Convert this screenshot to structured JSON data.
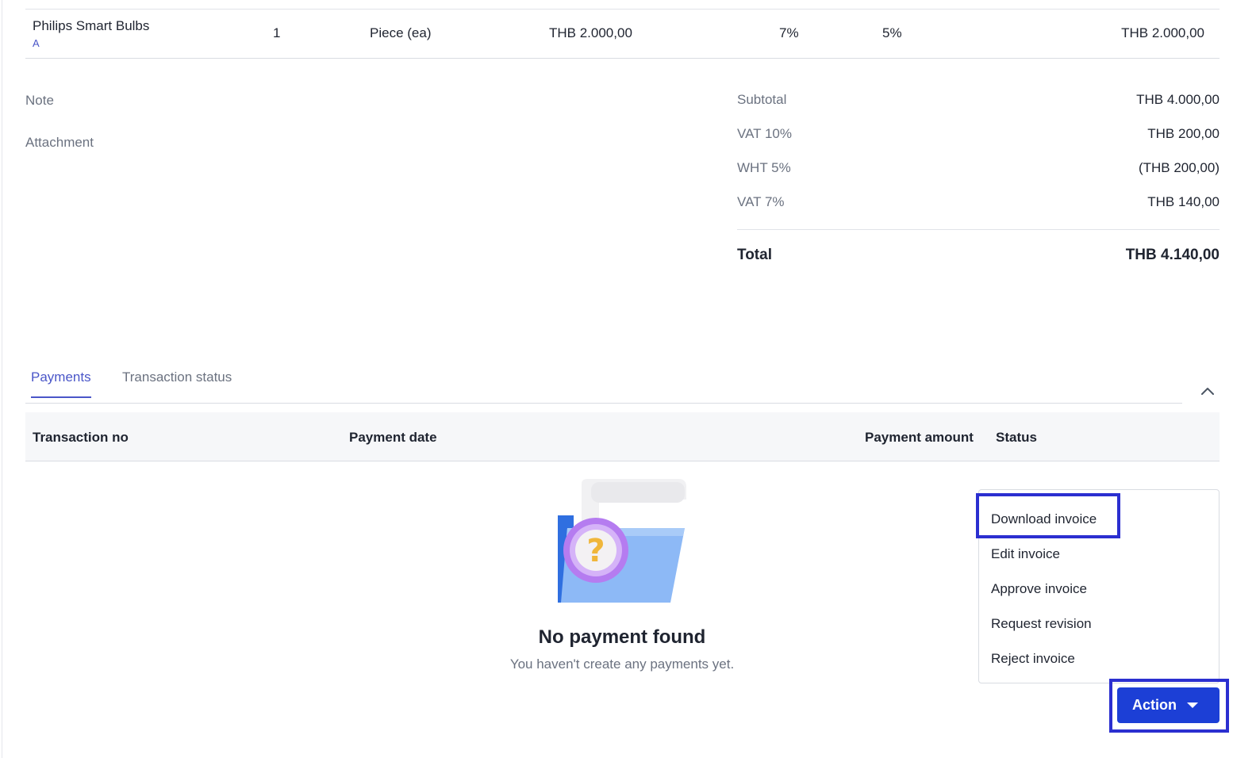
{
  "line_item": {
    "name": "Philips Smart Bulbs",
    "sub": "A",
    "quantity": "1",
    "unit": "Piece (ea)",
    "unit_price": "THB 2.000,00",
    "vat": "7%",
    "wht": "5%",
    "amount": "THB 2.000,00"
  },
  "meta": {
    "note_label": "Note",
    "attachment_label": "Attachment"
  },
  "summary": {
    "rows": [
      {
        "label": "Subtotal",
        "value": "THB 4.000,00"
      },
      {
        "label": "VAT 10%",
        "value": "THB 200,00"
      },
      {
        "label": "WHT 5%",
        "value": "(THB 200,00)"
      },
      {
        "label": "VAT 7%",
        "value": "THB 140,00"
      }
    ],
    "total_label": "Total",
    "total_value": "THB 4.140,00"
  },
  "tabs": {
    "payments": "Payments",
    "transaction_status": "Transaction status",
    "active": "payments"
  },
  "payments_table": {
    "columns": [
      "Transaction no",
      "Payment date",
      "Payment amount",
      "Status"
    ]
  },
  "empty_state": {
    "title": "No payment found",
    "subtitle": "You haven't create any payments yet.",
    "icon": "folder-question-illustration"
  },
  "action_menu": {
    "items": [
      "Download invoice",
      "Edit invoice",
      "Approve invoice",
      "Request revision",
      "Reject invoice"
    ],
    "button_label": "Action"
  },
  "colors": {
    "accent": "#4a56c8",
    "button": "#1c3fd6",
    "highlight": "#2b2fd0"
  }
}
